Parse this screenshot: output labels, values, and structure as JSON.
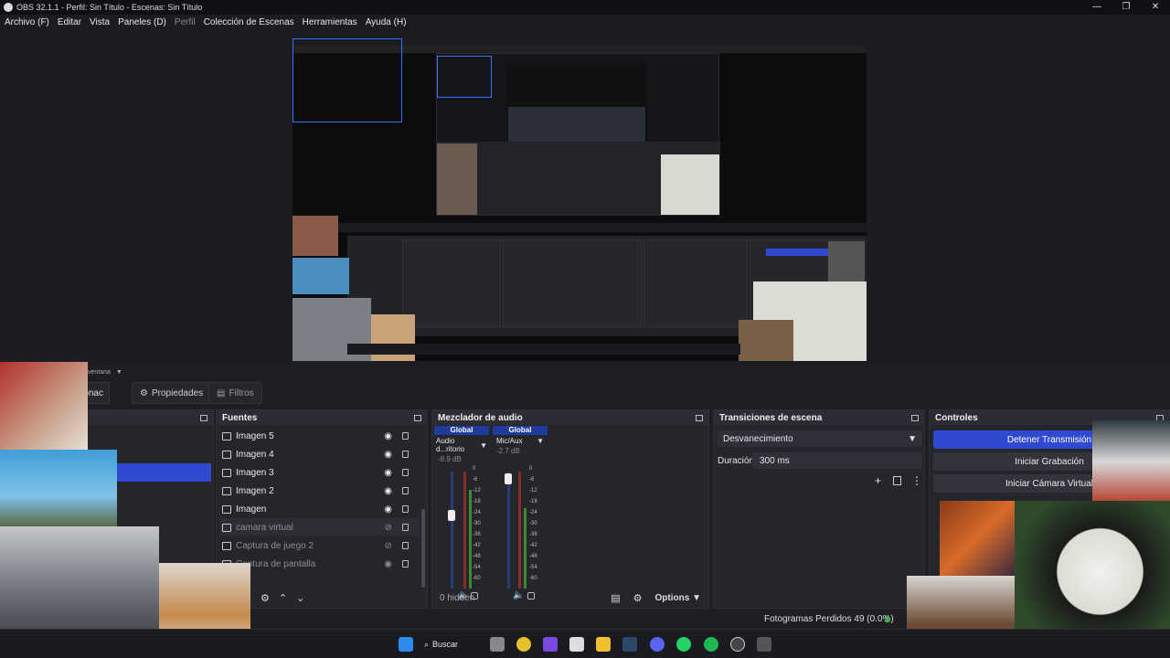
{
  "window": {
    "title": "OBS 32.1.1 - Perfil: Sin Título - Escenas: Sin Título",
    "controls": [
      "—",
      "❐",
      "✕"
    ]
  },
  "menu": {
    "items": [
      {
        "label": "Archivo (F)"
      },
      {
        "label": "Editar"
      },
      {
        "label": "Vista"
      },
      {
        "label": "Paneles (D)"
      },
      {
        "label": "Perfil"
      },
      {
        "label": "Colección de Escenas"
      },
      {
        "label": "Herramientas"
      },
      {
        "label": "Ayuda (H)"
      }
    ]
  },
  "dock_tabs": {
    "window_label": "ventana",
    "truncated_label": "onac",
    "properties": "Propiedades",
    "filters": "Filtros"
  },
  "sources": {
    "title": "Fuentes",
    "items": [
      {
        "label": "Imagen 5",
        "visible": true
      },
      {
        "label": "Imagen 4",
        "visible": true
      },
      {
        "label": "Imagen 3",
        "visible": true
      },
      {
        "label": "Imagen 2",
        "visible": true
      },
      {
        "label": "Imagen",
        "visible": true
      },
      {
        "label": "camara virtual",
        "visible": false
      },
      {
        "label": "Captura de juego 2",
        "visible": false
      },
      {
        "label": "Captura de pantalla",
        "visible": true
      }
    ]
  },
  "mixer": {
    "title": "Mezclador de audio",
    "channels": [
      {
        "header": "Global",
        "name": "Audio d...ritorio",
        "db": "-8.9 dB"
      },
      {
        "header": "Global",
        "name": "Mic/Aux",
        "db": "-2.7 dB"
      }
    ],
    "scale": [
      "0",
      "-6",
      "-12",
      "-18",
      "-24",
      "-30",
      "-36",
      "-42",
      "-48",
      "-54",
      "-60"
    ],
    "hidden": "0 hidden",
    "options": "Options"
  },
  "transitions": {
    "title": "Transiciones de escena",
    "selected": "Desvanecimiento",
    "duration_label": "Duración",
    "duration_value": "300 ms"
  },
  "controls": {
    "title": "Controles",
    "stream": "Detener Transmisión",
    "record": "Iniciar Grabación",
    "virtual_cam": "Iniciar Cámara Virtual"
  },
  "status": {
    "frames": "Fotogramas Perdidos 49 (0.0%)"
  },
  "taskbar": {
    "search": "Buscar"
  },
  "colors": {
    "accent": "#2f4ad0",
    "bg": "#1e1f24",
    "panel": "#25262c"
  }
}
